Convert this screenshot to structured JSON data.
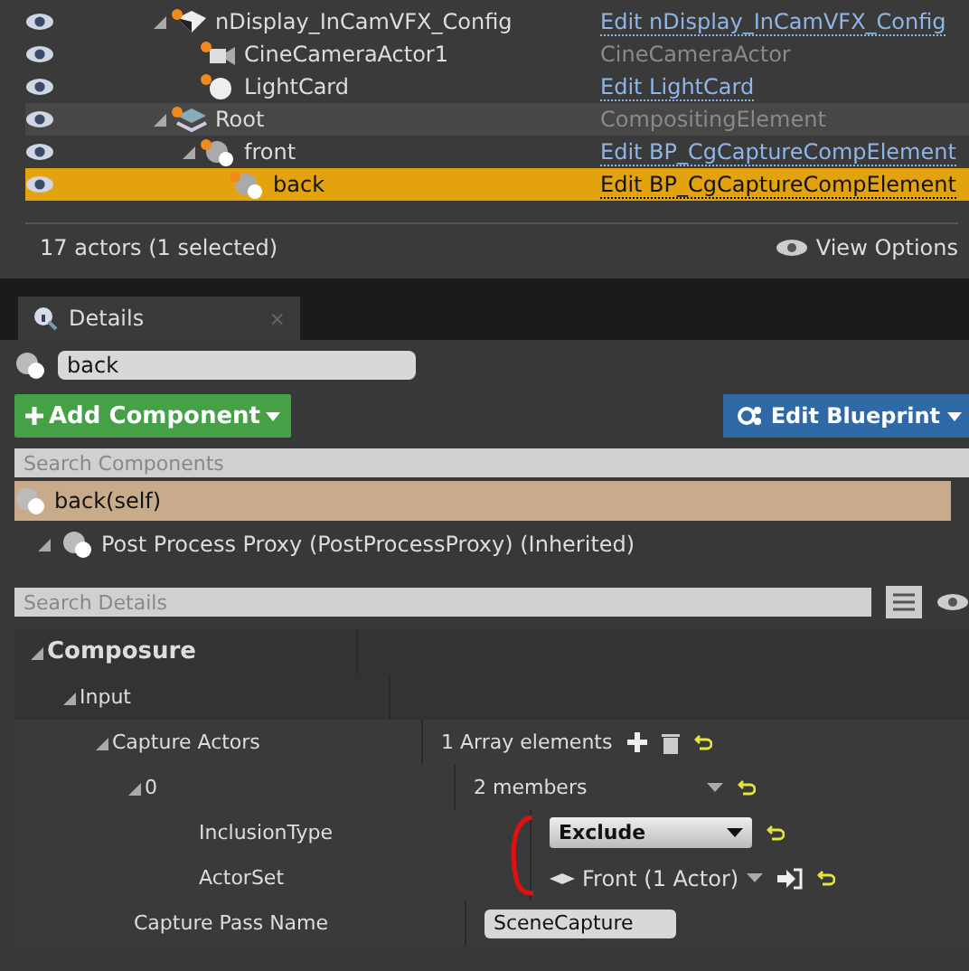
{
  "outliner": {
    "rows": [
      {
        "label": "nDisplay_InCamVFX_Config",
        "type": "Edit nDisplay_InCamVFX_Config",
        "type_link": true,
        "kind": "config",
        "expanded": true,
        "selected": false,
        "highlighted": false,
        "children": [
          {
            "label": "CineCameraActor1",
            "type": "CineCameraActor",
            "type_link": false,
            "kind": "camera",
            "selected": false,
            "highlighted": false
          },
          {
            "label": "LightCard",
            "type": "Edit LightCard",
            "type_link": true,
            "kind": "sphere",
            "selected": false,
            "highlighted": false
          }
        ]
      },
      {
        "label": "Root",
        "type": "CompositingElement",
        "type_link": false,
        "kind": "layers",
        "expanded": true,
        "selected": false,
        "highlighted": true,
        "children": [
          {
            "label": "front",
            "type": "Edit BP_CgCaptureCompElement",
            "type_link": true,
            "kind": "element",
            "expanded": true,
            "selected": false,
            "highlighted": false,
            "children": [
              {
                "label": "back",
                "type": "Edit BP_CgCaptureCompElement",
                "type_link": true,
                "kind": "element",
                "selected": true,
                "highlighted": false
              }
            ]
          }
        ]
      }
    ],
    "status": "17 actors (1 selected)",
    "view_options": "View Options"
  },
  "details": {
    "tab": "Details",
    "tab_close": "×",
    "name": "back",
    "add_button": "Add Component",
    "blueprint_button": "Edit Blueprint",
    "components_search": {
      "placeholder": "Search Components"
    },
    "components": [
      {
        "label": "back(self)",
        "selected": true,
        "expanded": false
      },
      {
        "label": "Post Process Proxy (PostProcessProxy) (Inherited)",
        "selected": false,
        "expanded": true
      }
    ],
    "details_search": {
      "placeholder": "Search Details"
    },
    "properties": [
      {
        "label": "Composure",
        "kind": "category",
        "expanded": true,
        "children": [
          {
            "label": "Input",
            "kind": "subcategory",
            "expanded": true,
            "children": [
              {
                "label": "Capture Actors",
                "kind": "array",
                "value": "1 Array elements",
                "expanded": true,
                "children": [
                  {
                    "label": "0",
                    "kind": "struct",
                    "value": "2 members",
                    "expanded": true,
                    "children": [
                      {
                        "label": "InclusionType",
                        "kind": "combo",
                        "value": "Exclude"
                      },
                      {
                        "label": "ActorSet",
                        "kind": "actorset",
                        "value": "Front (1 Actor)"
                      }
                    ]
                  }
                ]
              },
              {
                "label": "Capture Pass Name",
                "kind": "text",
                "value": "SceneCapture"
              }
            ]
          }
        ]
      }
    ]
  }
}
